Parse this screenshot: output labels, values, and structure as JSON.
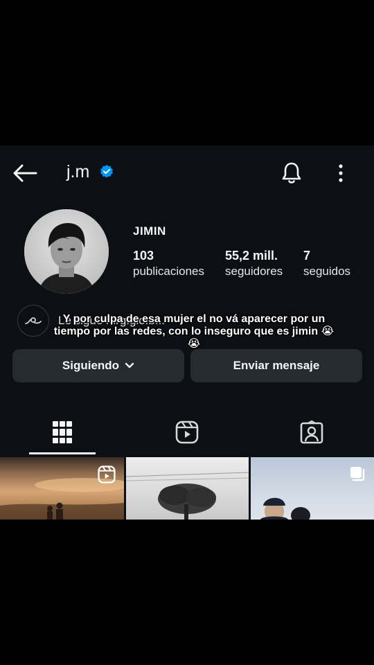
{
  "header": {
    "username": "j.m",
    "back_icon": "arrow-left-icon",
    "verified_icon": "verified-badge-icon",
    "bell_icon": "bell-icon",
    "more_icon": "more-vertical-icon"
  },
  "profile": {
    "display_name": "JIMIN",
    "stats": [
      {
        "value": "103",
        "label": "publicaciones"
      },
      {
        "value": "55,2 mill.",
        "label": "seguidores"
      },
      {
        "value": "7",
        "label": "seguidos"
      }
    ],
    "threads_text": "Le sigue mrg.glo.b..."
  },
  "overlay_caption": "Y por culpa de esa mujer el no vá aparecer por un tiempo por las redes, con lo inseguro que es jimin 😭😭",
  "actions": {
    "following_label": "Siguiendo",
    "message_label": "Enviar mensaje"
  },
  "tabs": [
    {
      "name": "posts-grid",
      "icon": "grid-icon",
      "active": true
    },
    {
      "name": "reels",
      "icon": "reels-icon",
      "active": false
    },
    {
      "name": "tagged",
      "icon": "tagged-user-icon",
      "active": false
    }
  ],
  "colors": {
    "background": "#0c1014",
    "button": "#262b31",
    "verified": "#0095f6",
    "text": "#f5f5f5"
  }
}
